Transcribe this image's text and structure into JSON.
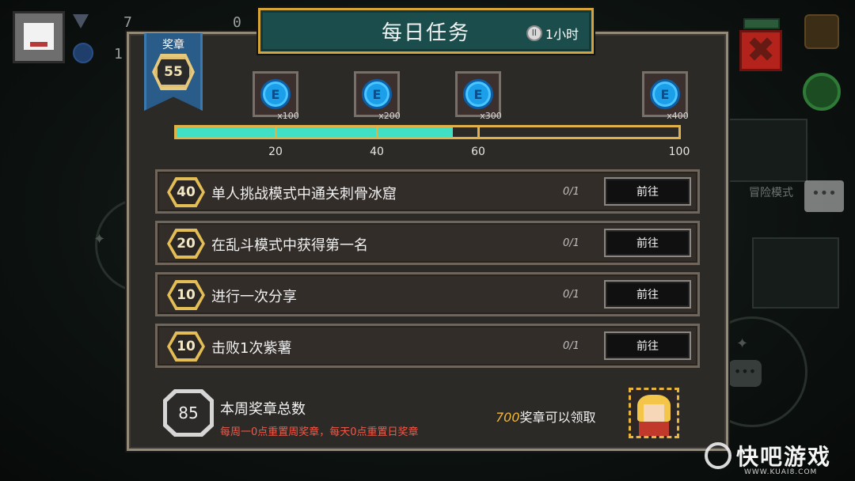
{
  "hud": {
    "gems": "7",
    "coins": "1",
    "materials": "0"
  },
  "panel": {
    "title": "每日任务",
    "timer": "1小时",
    "timer_icon": "pause-icon"
  },
  "medals": {
    "label": "奖章",
    "count": "55"
  },
  "rewards": [
    {
      "amount": "x100",
      "icon": "blue-gem-coin-icon",
      "at": 20
    },
    {
      "amount": "x200",
      "icon": "blue-gem-coin-icon",
      "at": 40
    },
    {
      "amount": "x300",
      "icon": "blue-gem-coin-icon",
      "at": 60
    },
    {
      "amount": "x400",
      "icon": "blue-gem-coin-icon",
      "at": 100
    }
  ],
  "progress": {
    "value": 55,
    "max": 100,
    "ticks": [
      "20",
      "40",
      "60",
      "100"
    ]
  },
  "tasks": [
    {
      "points": "40",
      "text": "单人挑战模式中通关刺骨冰窟",
      "progress": "0/1",
      "button": "前往"
    },
    {
      "points": "20",
      "text": "在乱斗模式中获得第一名",
      "progress": "0/1",
      "button": "前往"
    },
    {
      "points": "10",
      "text": "进行一次分享",
      "progress": "0/1",
      "button": "前往"
    },
    {
      "points": "10",
      "text": "击败1次紫薯",
      "progress": "0/1",
      "button": "前往"
    }
  ],
  "footer": {
    "week_total": "85",
    "week_title": "本周奖章总数",
    "reset_note": "每周一0点重置周奖章，每天0点重置日奖章",
    "claim_number": "700",
    "claim_suffix": "奖章可以领取"
  },
  "side": {
    "adventure_label": "冒险模式",
    "chat_icon": "chat-bubble-icon"
  },
  "watermark": {
    "text": "快吧游戏",
    "url": "WWW.KUAI8.COM"
  },
  "colors": {
    "title_plate": "#1a4d4b",
    "gold": "#e0b04a",
    "progress_fill": "#3fe0c4",
    "ribbon": "#2a5c8a",
    "close": "#b3231c",
    "note_red": "#ee5a4a"
  }
}
